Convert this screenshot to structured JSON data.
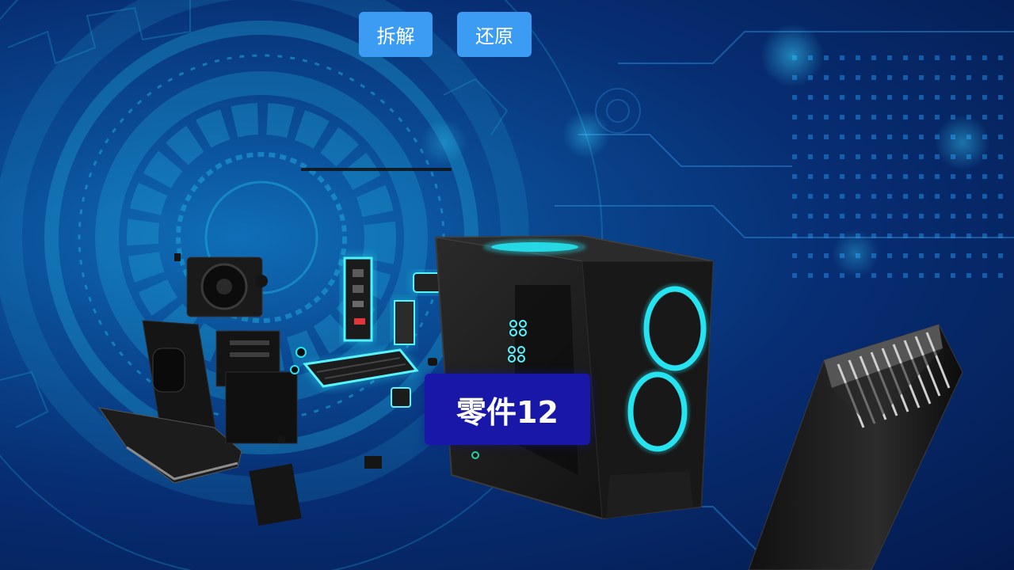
{
  "toolbar": {
    "disassemble_label": "拆解",
    "restore_label": "还原"
  },
  "scene": {
    "part_label": "零件12",
    "colors": {
      "background": "#072d72",
      "accent_glow": "#26e3f0",
      "button": "#3c9cf4",
      "label_bg": "#1817a8"
    }
  }
}
